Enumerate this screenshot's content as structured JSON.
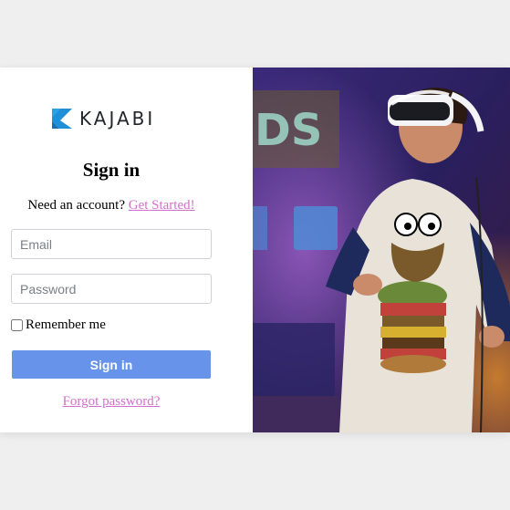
{
  "brand": {
    "name": "KAJABI",
    "accent": "#1f8fd6"
  },
  "login": {
    "title": "Sign in",
    "prompt": "Need an account?",
    "signup_link": "Get Started!",
    "email_placeholder": "Email",
    "password_placeholder": "Password",
    "remember_label": "Remember me",
    "submit_label": "Sign in",
    "forgot_link": "Forgot password?"
  },
  "colors": {
    "button": "#6794ea",
    "link": "#d26fce",
    "background": "#efefef"
  },
  "hero": {
    "image": "person-wearing-vr-headset-photo"
  }
}
